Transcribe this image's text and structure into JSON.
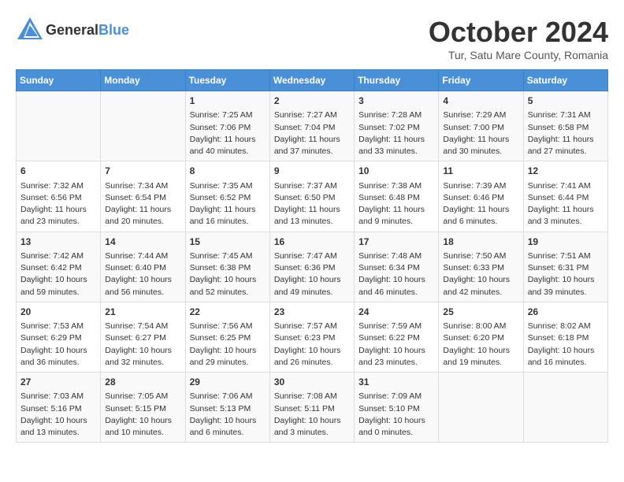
{
  "header": {
    "logo_general": "General",
    "logo_blue": "Blue",
    "title": "October 2024",
    "location": "Tur, Satu Mare County, Romania"
  },
  "days_of_week": [
    "Sunday",
    "Monday",
    "Tuesday",
    "Wednesday",
    "Thursday",
    "Friday",
    "Saturday"
  ],
  "weeks": [
    [
      {
        "day": "",
        "info": ""
      },
      {
        "day": "",
        "info": ""
      },
      {
        "day": "1",
        "info": "Sunrise: 7:25 AM\nSunset: 7:06 PM\nDaylight: 11 hours and 40 minutes."
      },
      {
        "day": "2",
        "info": "Sunrise: 7:27 AM\nSunset: 7:04 PM\nDaylight: 11 hours and 37 minutes."
      },
      {
        "day": "3",
        "info": "Sunrise: 7:28 AM\nSunset: 7:02 PM\nDaylight: 11 hours and 33 minutes."
      },
      {
        "day": "4",
        "info": "Sunrise: 7:29 AM\nSunset: 7:00 PM\nDaylight: 11 hours and 30 minutes."
      },
      {
        "day": "5",
        "info": "Sunrise: 7:31 AM\nSunset: 6:58 PM\nDaylight: 11 hours and 27 minutes."
      }
    ],
    [
      {
        "day": "6",
        "info": "Sunrise: 7:32 AM\nSunset: 6:56 PM\nDaylight: 11 hours and 23 minutes."
      },
      {
        "day": "7",
        "info": "Sunrise: 7:34 AM\nSunset: 6:54 PM\nDaylight: 11 hours and 20 minutes."
      },
      {
        "day": "8",
        "info": "Sunrise: 7:35 AM\nSunset: 6:52 PM\nDaylight: 11 hours and 16 minutes."
      },
      {
        "day": "9",
        "info": "Sunrise: 7:37 AM\nSunset: 6:50 PM\nDaylight: 11 hours and 13 minutes."
      },
      {
        "day": "10",
        "info": "Sunrise: 7:38 AM\nSunset: 6:48 PM\nDaylight: 11 hours and 9 minutes."
      },
      {
        "day": "11",
        "info": "Sunrise: 7:39 AM\nSunset: 6:46 PM\nDaylight: 11 hours and 6 minutes."
      },
      {
        "day": "12",
        "info": "Sunrise: 7:41 AM\nSunset: 6:44 PM\nDaylight: 11 hours and 3 minutes."
      }
    ],
    [
      {
        "day": "13",
        "info": "Sunrise: 7:42 AM\nSunset: 6:42 PM\nDaylight: 10 hours and 59 minutes."
      },
      {
        "day": "14",
        "info": "Sunrise: 7:44 AM\nSunset: 6:40 PM\nDaylight: 10 hours and 56 minutes."
      },
      {
        "day": "15",
        "info": "Sunrise: 7:45 AM\nSunset: 6:38 PM\nDaylight: 10 hours and 52 minutes."
      },
      {
        "day": "16",
        "info": "Sunrise: 7:47 AM\nSunset: 6:36 PM\nDaylight: 10 hours and 49 minutes."
      },
      {
        "day": "17",
        "info": "Sunrise: 7:48 AM\nSunset: 6:34 PM\nDaylight: 10 hours and 46 minutes."
      },
      {
        "day": "18",
        "info": "Sunrise: 7:50 AM\nSunset: 6:33 PM\nDaylight: 10 hours and 42 minutes."
      },
      {
        "day": "19",
        "info": "Sunrise: 7:51 AM\nSunset: 6:31 PM\nDaylight: 10 hours and 39 minutes."
      }
    ],
    [
      {
        "day": "20",
        "info": "Sunrise: 7:53 AM\nSunset: 6:29 PM\nDaylight: 10 hours and 36 minutes."
      },
      {
        "day": "21",
        "info": "Sunrise: 7:54 AM\nSunset: 6:27 PM\nDaylight: 10 hours and 32 minutes."
      },
      {
        "day": "22",
        "info": "Sunrise: 7:56 AM\nSunset: 6:25 PM\nDaylight: 10 hours and 29 minutes."
      },
      {
        "day": "23",
        "info": "Sunrise: 7:57 AM\nSunset: 6:23 PM\nDaylight: 10 hours and 26 minutes."
      },
      {
        "day": "24",
        "info": "Sunrise: 7:59 AM\nSunset: 6:22 PM\nDaylight: 10 hours and 23 minutes."
      },
      {
        "day": "25",
        "info": "Sunrise: 8:00 AM\nSunset: 6:20 PM\nDaylight: 10 hours and 19 minutes."
      },
      {
        "day": "26",
        "info": "Sunrise: 8:02 AM\nSunset: 6:18 PM\nDaylight: 10 hours and 16 minutes."
      }
    ],
    [
      {
        "day": "27",
        "info": "Sunrise: 7:03 AM\nSunset: 5:16 PM\nDaylight: 10 hours and 13 minutes."
      },
      {
        "day": "28",
        "info": "Sunrise: 7:05 AM\nSunset: 5:15 PM\nDaylight: 10 hours and 10 minutes."
      },
      {
        "day": "29",
        "info": "Sunrise: 7:06 AM\nSunset: 5:13 PM\nDaylight: 10 hours and 6 minutes."
      },
      {
        "day": "30",
        "info": "Sunrise: 7:08 AM\nSunset: 5:11 PM\nDaylight: 10 hours and 3 minutes."
      },
      {
        "day": "31",
        "info": "Sunrise: 7:09 AM\nSunset: 5:10 PM\nDaylight: 10 hours and 0 minutes."
      },
      {
        "day": "",
        "info": ""
      },
      {
        "day": "",
        "info": ""
      }
    ]
  ]
}
